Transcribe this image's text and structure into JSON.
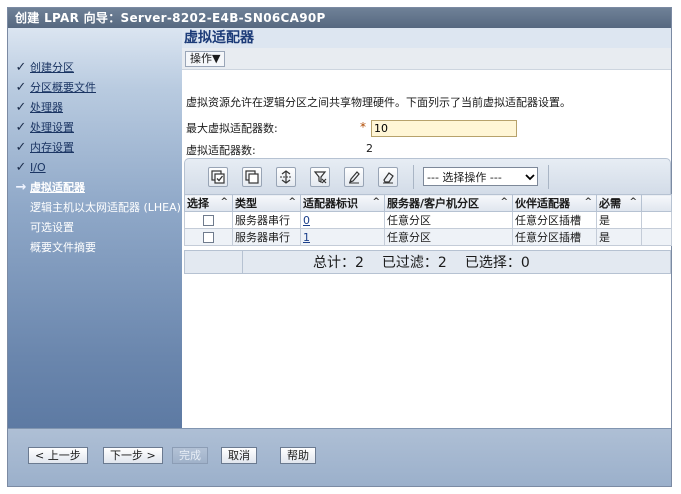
{
  "window": {
    "title": "创建 LPAR 向导：Server-8202-E4B-SN06CA90P"
  },
  "sidebar": {
    "items": [
      {
        "label": "创建分区",
        "mark": "check"
      },
      {
        "label": "分区概要文件",
        "mark": "check"
      },
      {
        "label": "处理器",
        "mark": "check"
      },
      {
        "label": "处理设置",
        "mark": "check"
      },
      {
        "label": "内存设置",
        "mark": "check"
      },
      {
        "label": "I/O",
        "mark": "check"
      },
      {
        "label": "虚拟适配器",
        "mark": "arrow"
      },
      {
        "label": "逻辑主机以太网适配器 (LHEA)",
        "mark": "none"
      },
      {
        "label": "可选设置",
        "mark": "none"
      },
      {
        "label": "概要文件摘要",
        "mark": "none"
      }
    ]
  },
  "main": {
    "title": "虚拟适配器",
    "action_menu": "操作▼",
    "description": "虚拟资源允许在逻辑分区之间共享物理硬件。下面列示了当前虚拟适配器设置。",
    "max_adapters_label": "最大虚拟适配器数:",
    "required_mark": "*",
    "max_adapters_value": "10",
    "adapter_count_label": "虚拟适配器数:",
    "adapter_count_value": "2",
    "toolbar": {
      "select_action": "--- 选择操作 ---",
      "icons": [
        "select-all-icon",
        "deselect-all-icon",
        "show-filter-icon",
        "clear-filter-icon",
        "edit-sort-icon",
        "clear-sort-icon"
      ]
    },
    "table": {
      "columns": [
        "选择",
        "类型",
        "适配器标识",
        "服务器/客户机分区",
        "伙伴适配器",
        "必需"
      ],
      "rows": [
        {
          "type": "服务器串行",
          "id": "0",
          "partition": "任意分区",
          "partner": "任意分区插槽",
          "required": "是"
        },
        {
          "type": "服务器串行",
          "id": "1",
          "partition": "任意分区",
          "partner": "任意分区插槽",
          "required": "是"
        }
      ],
      "footer": {
        "total": "总计：2",
        "filtered": "已过滤：2",
        "selected": "已选择：0"
      }
    }
  },
  "buttons": {
    "back": "< 上一步",
    "next": "下一步 >",
    "finish": "完成",
    "cancel": "取消",
    "help": "帮助"
  }
}
